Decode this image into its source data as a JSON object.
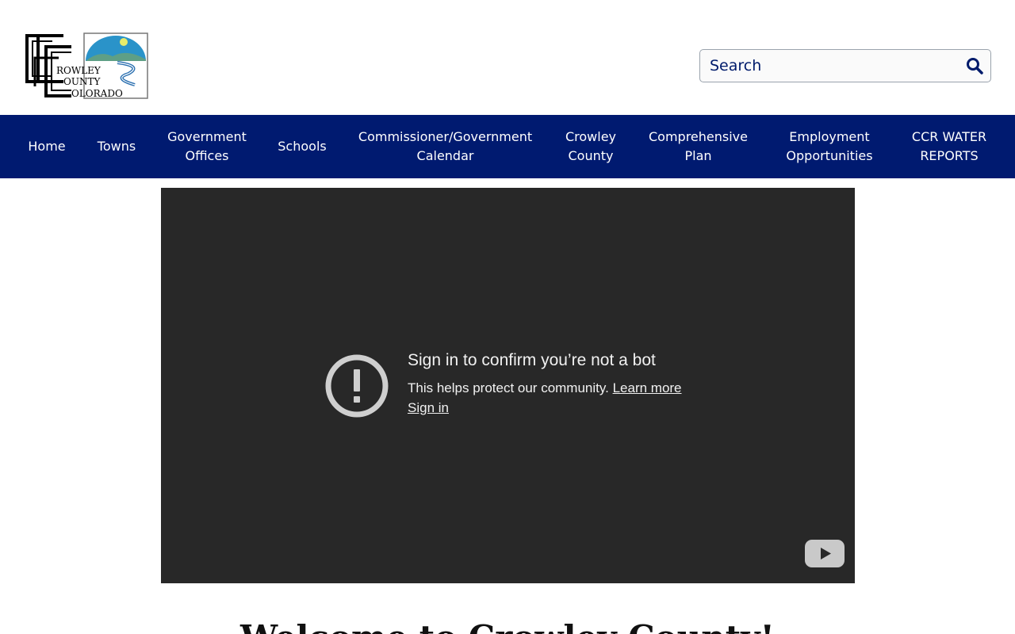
{
  "header": {
    "logo": {
      "line1": "ROWLEY",
      "line2": "OUNTY",
      "line3": "OLORADO"
    },
    "search": {
      "placeholder": "Search",
      "icon": "search-icon"
    }
  },
  "nav": {
    "items": [
      {
        "label": "Home"
      },
      {
        "label": "Towns"
      },
      {
        "label": "Government\nOffices"
      },
      {
        "label": "Schools"
      },
      {
        "label": "Commissioner/Government\nCalendar"
      },
      {
        "label": "Crowley\nCounty"
      },
      {
        "label": "Comprehensive\nPlan"
      },
      {
        "label": "Employment\nOpportunities"
      },
      {
        "label": "CCR WATER\nREPORTS"
      }
    ]
  },
  "video": {
    "title": "Sign in to confirm you’re not a bot",
    "body": "This helps protect our community.",
    "learn_more": "Learn more",
    "sign_in": "Sign in",
    "icon": "alert-icon",
    "play_icon": "youtube-icon"
  },
  "main": {
    "heading": "Welcome to Crowley County!"
  },
  "colors": {
    "nav_bg": "#001a70",
    "video_bg": "#282828",
    "text_accent": "#001b6b"
  }
}
